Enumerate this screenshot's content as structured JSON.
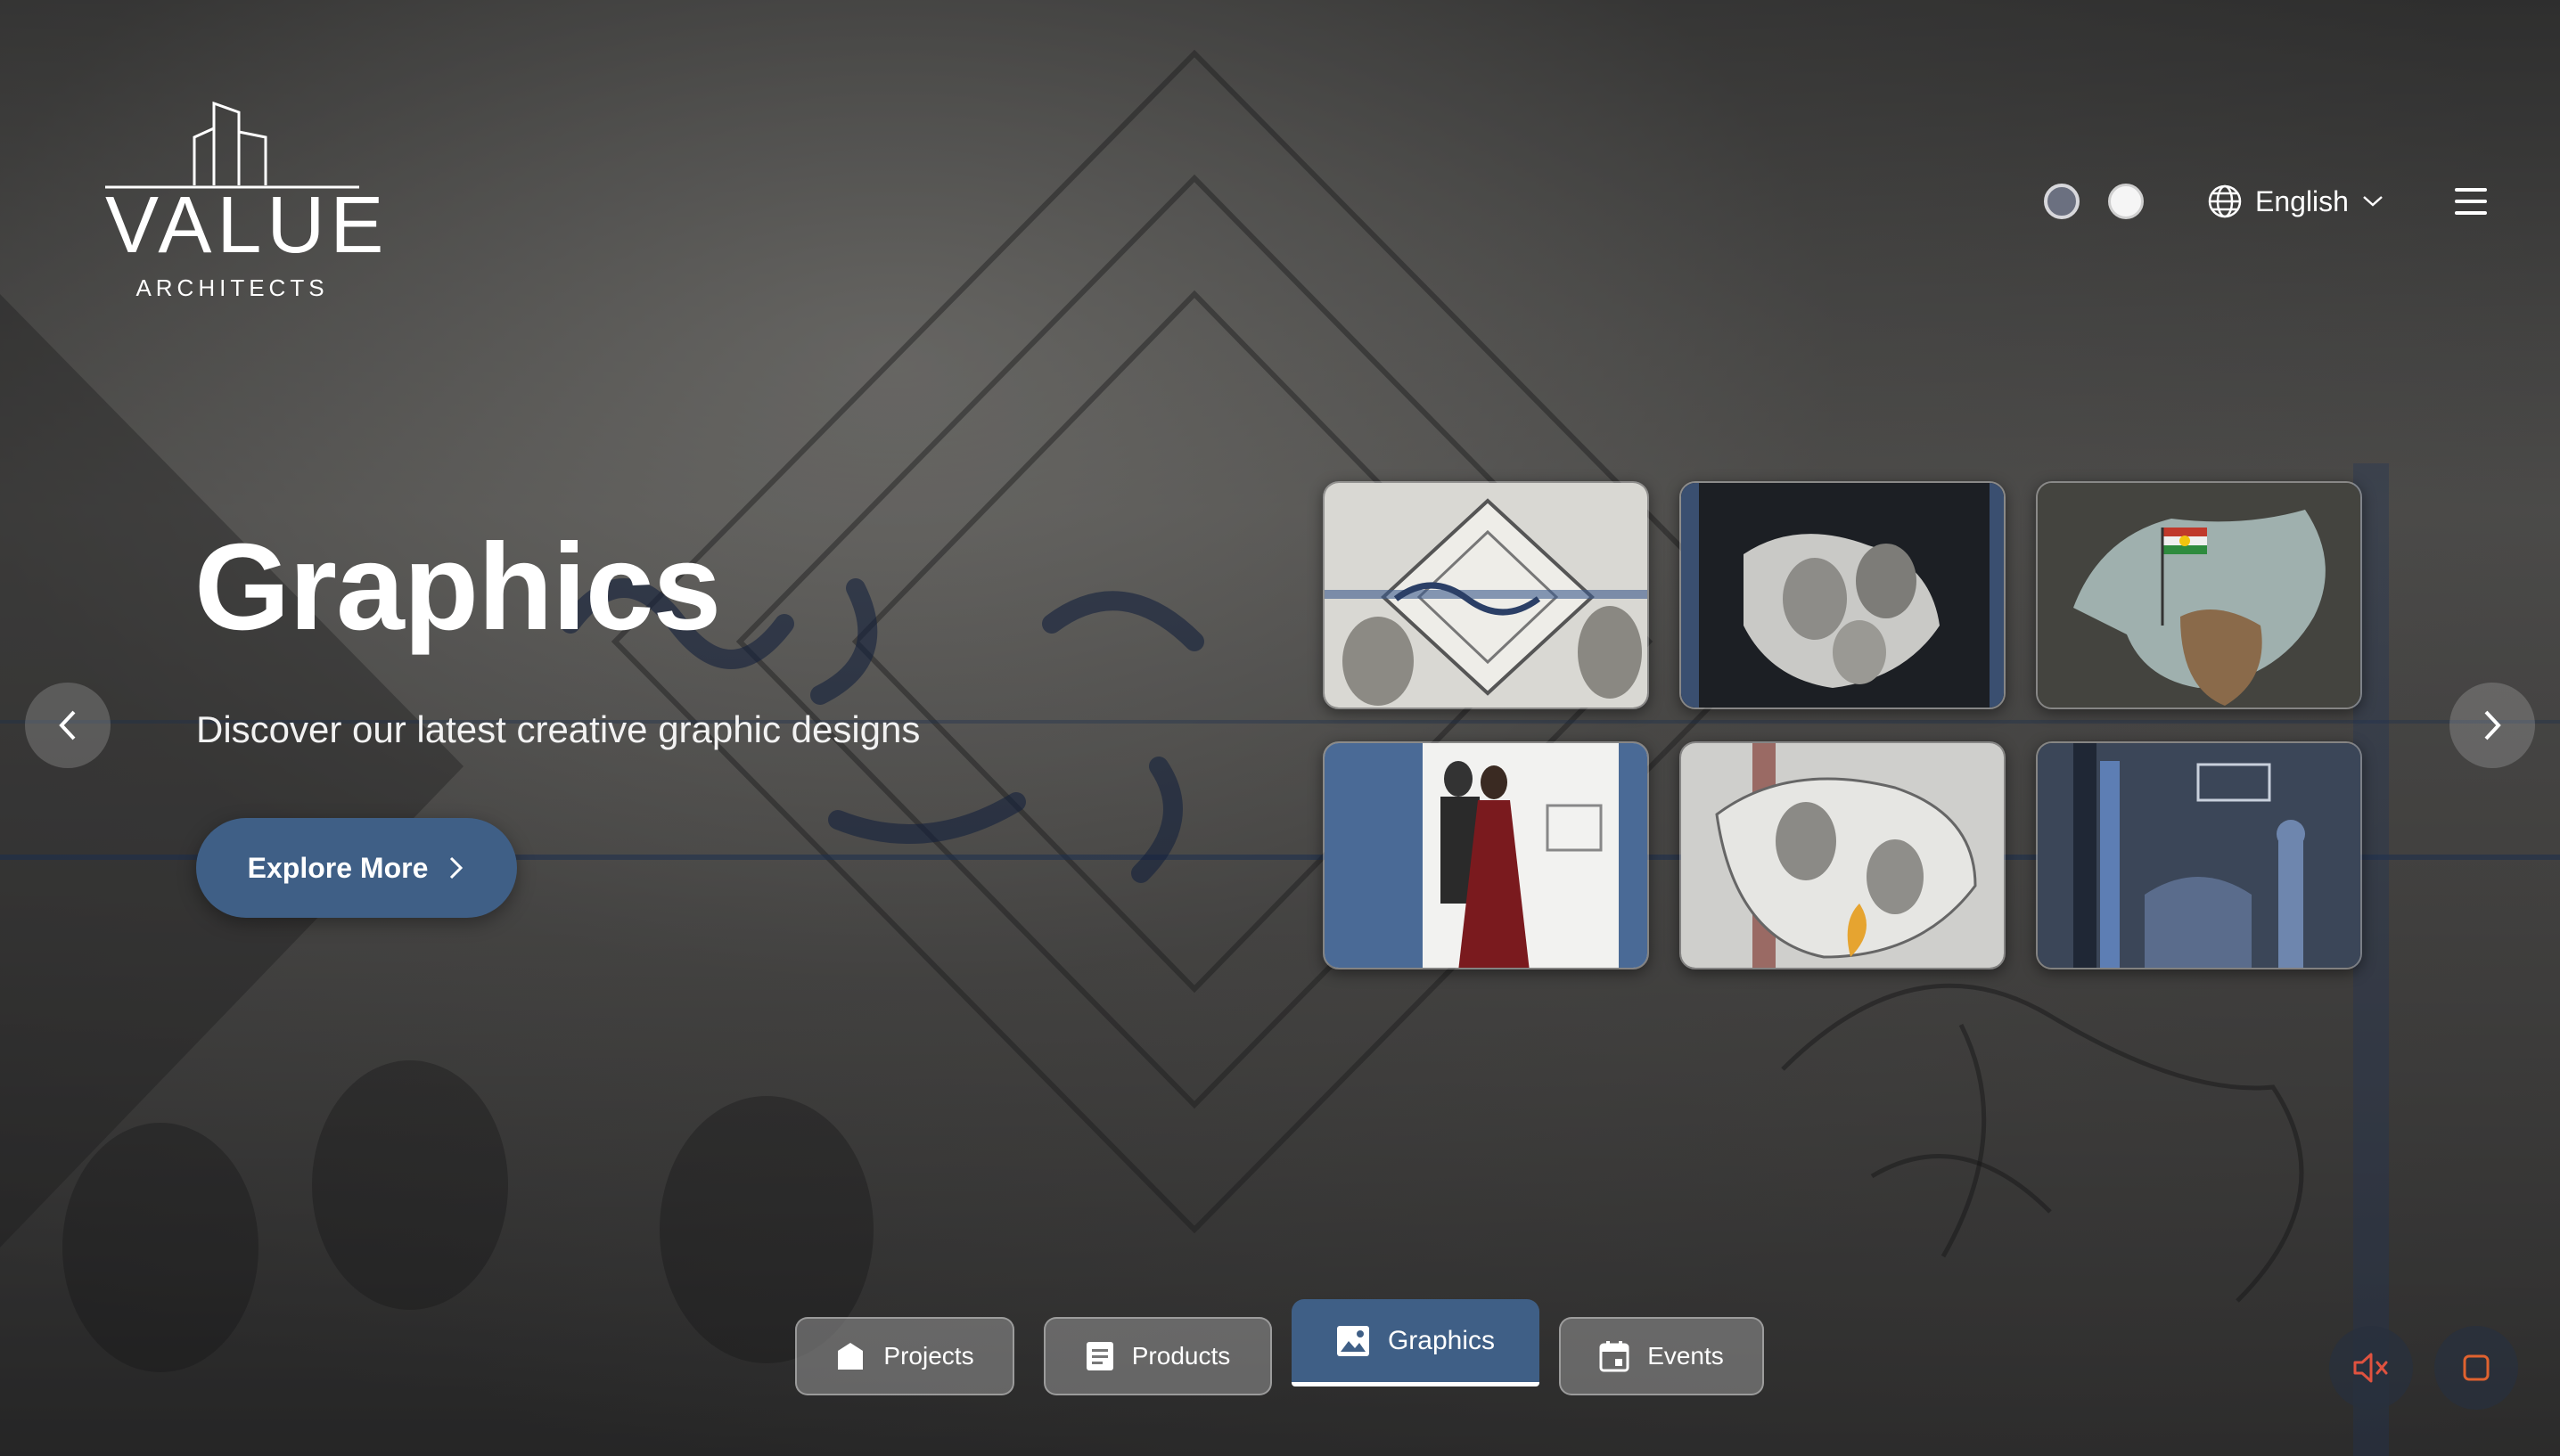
{
  "brand": {
    "name": "VALUE",
    "subtitle": "ARCHITECTS"
  },
  "header": {
    "theme_options": [
      "dark",
      "light"
    ],
    "language": {
      "selected": "English",
      "icon": "globe-icon"
    },
    "menu_icon": "hamburger-menu-icon"
  },
  "hero": {
    "title": "Graphics",
    "subtitle": "Discover our latest creative graphic designs",
    "cta_label": "Explore More"
  },
  "gallery": {
    "items": [
      {
        "name": "graphic-thumb-1"
      },
      {
        "name": "graphic-thumb-2"
      },
      {
        "name": "graphic-thumb-3"
      },
      {
        "name": "graphic-thumb-4"
      },
      {
        "name": "graphic-thumb-5"
      },
      {
        "name": "graphic-thumb-6"
      }
    ]
  },
  "tabs": [
    {
      "label": "Projects",
      "icon": "projects-icon",
      "active": false
    },
    {
      "label": "Products",
      "icon": "products-icon",
      "active": false
    },
    {
      "label": "Graphics",
      "icon": "image-icon",
      "active": true
    },
    {
      "label": "Events",
      "icon": "calendar-icon",
      "active": false
    }
  ],
  "controls": {
    "sound": "muted",
    "sound_icon": "speaker-muted-icon",
    "stop_icon": "stop-icon"
  },
  "colors": {
    "accent": "#3f5f86",
    "mute_icon": "#e0523f",
    "stop_icon": "#e0622f"
  }
}
